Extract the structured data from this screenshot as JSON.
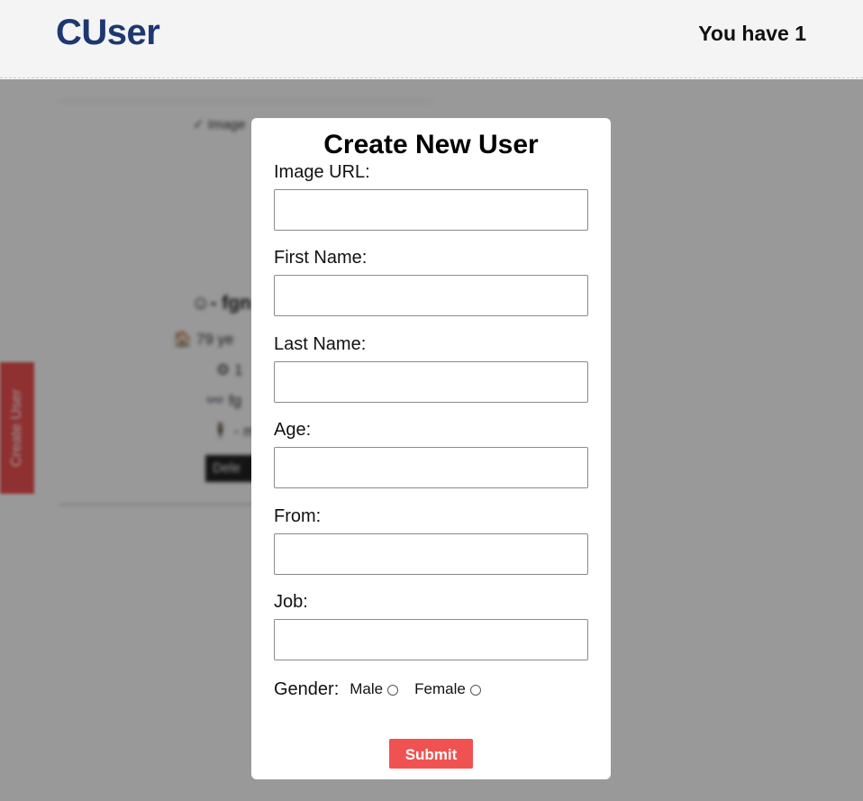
{
  "header": {
    "brand": "CUser",
    "counter_text": "You have 1"
  },
  "background": {
    "card": {
      "image_alt": "✓ Image",
      "name": "☺- fgn",
      "info": [
        "🏠 79 ye",
        "⚙ 1",
        "👓 fg",
        "🕴 - m"
      ],
      "delete_label": "Dele"
    },
    "side_tab_label": "Create User"
  },
  "modal": {
    "title": "Create New User",
    "fields": [
      {
        "label": "Image URL:",
        "value": "",
        "placeholder": ""
      },
      {
        "label": "First Name:",
        "value": "",
        "placeholder": ""
      },
      {
        "label": "Last Name:",
        "value": "",
        "placeholder": ""
      },
      {
        "label": "Age:",
        "value": "",
        "placeholder": ""
      },
      {
        "label": "From:",
        "value": "",
        "placeholder": ""
      },
      {
        "label": "Job:",
        "value": "",
        "placeholder": ""
      }
    ],
    "gender": {
      "label": "Gender:",
      "options": [
        "Male",
        "Female"
      ],
      "selected": ""
    },
    "submit_label": "Submit"
  },
  "colors": {
    "brand": "#1d3870",
    "accent": "#f05252",
    "overlay": "rgba(0,0,0,0.4)"
  }
}
